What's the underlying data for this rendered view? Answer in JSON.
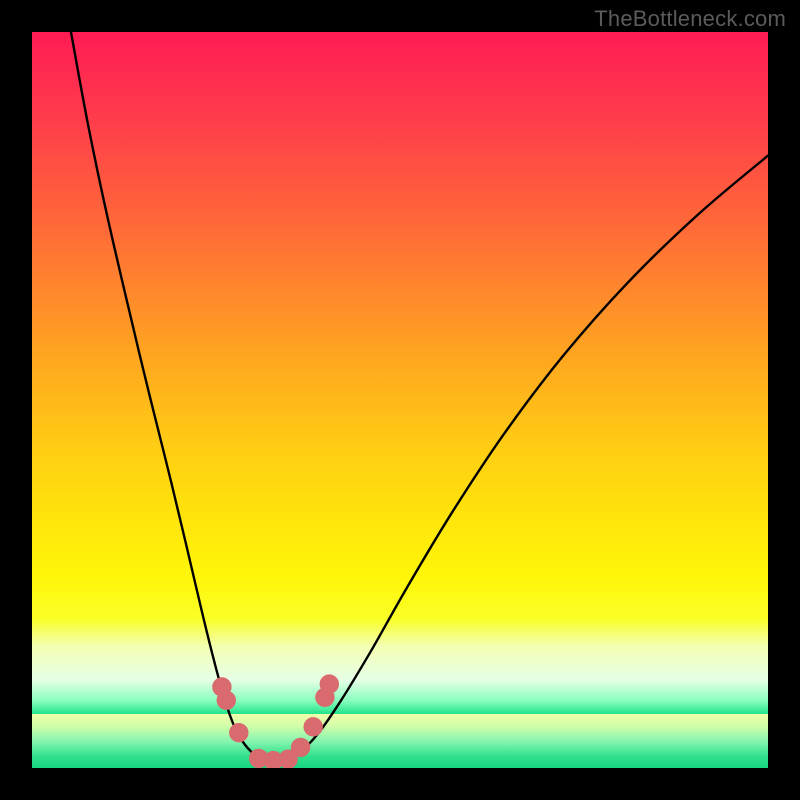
{
  "watermark": "TheBottleneck.com",
  "colors": {
    "background": "#000000",
    "gradient_top": "#ff1c54",
    "gradient_mid": "#ffe60b",
    "gradient_bottom": "#16d583",
    "curve_stroke": "#000000",
    "bead_fill": "#d96a6e"
  },
  "chart_data": {
    "type": "line",
    "title": "",
    "xlabel": "",
    "ylabel": "",
    "xlim": [
      0,
      1
    ],
    "ylim": [
      0,
      1
    ],
    "note": "Axes are unlabeled. Values normalized to the plot area (0..1). Two monotone curves forming a V; red beads cluster near the trough.",
    "series": [
      {
        "name": "left_curve",
        "points": [
          {
            "x": 0.053,
            "y": 1.0
          },
          {
            "x": 0.075,
            "y": 0.88
          },
          {
            "x": 0.1,
            "y": 0.76
          },
          {
            "x": 0.13,
            "y": 0.63
          },
          {
            "x": 0.16,
            "y": 0.505
          },
          {
            "x": 0.19,
            "y": 0.385
          },
          {
            "x": 0.215,
            "y": 0.28
          },
          {
            "x": 0.235,
            "y": 0.195
          },
          {
            "x": 0.252,
            "y": 0.128
          },
          {
            "x": 0.266,
            "y": 0.08
          },
          {
            "x": 0.28,
            "y": 0.046
          },
          {
            "x": 0.298,
            "y": 0.022
          },
          {
            "x": 0.318,
            "y": 0.01
          },
          {
            "x": 0.34,
            "y": 0.01
          }
        ]
      },
      {
        "name": "right_curve",
        "points": [
          {
            "x": 0.34,
            "y": 0.01
          },
          {
            "x": 0.362,
            "y": 0.02
          },
          {
            "x": 0.388,
            "y": 0.046
          },
          {
            "x": 0.42,
            "y": 0.092
          },
          {
            "x": 0.46,
            "y": 0.158
          },
          {
            "x": 0.51,
            "y": 0.246
          },
          {
            "x": 0.57,
            "y": 0.346
          },
          {
            "x": 0.64,
            "y": 0.452
          },
          {
            "x": 0.72,
            "y": 0.558
          },
          {
            "x": 0.81,
            "y": 0.66
          },
          {
            "x": 0.905,
            "y": 0.752
          },
          {
            "x": 1.0,
            "y": 0.832
          }
        ]
      }
    ],
    "beads": [
      {
        "x": 0.258,
        "y": 0.11,
        "r": 0.025
      },
      {
        "x": 0.264,
        "y": 0.092,
        "r": 0.025
      },
      {
        "x": 0.281,
        "y": 0.048,
        "r": 0.025
      },
      {
        "x": 0.308,
        "y": 0.013,
        "r": 0.025
      },
      {
        "x": 0.328,
        "y": 0.01,
        "r": 0.025
      },
      {
        "x": 0.348,
        "y": 0.012,
        "r": 0.025
      },
      {
        "x": 0.365,
        "y": 0.028,
        "r": 0.025
      },
      {
        "x": 0.382,
        "y": 0.056,
        "r": 0.025
      },
      {
        "x": 0.398,
        "y": 0.096,
        "r": 0.025
      },
      {
        "x": 0.404,
        "y": 0.114,
        "r": 0.025
      }
    ]
  }
}
